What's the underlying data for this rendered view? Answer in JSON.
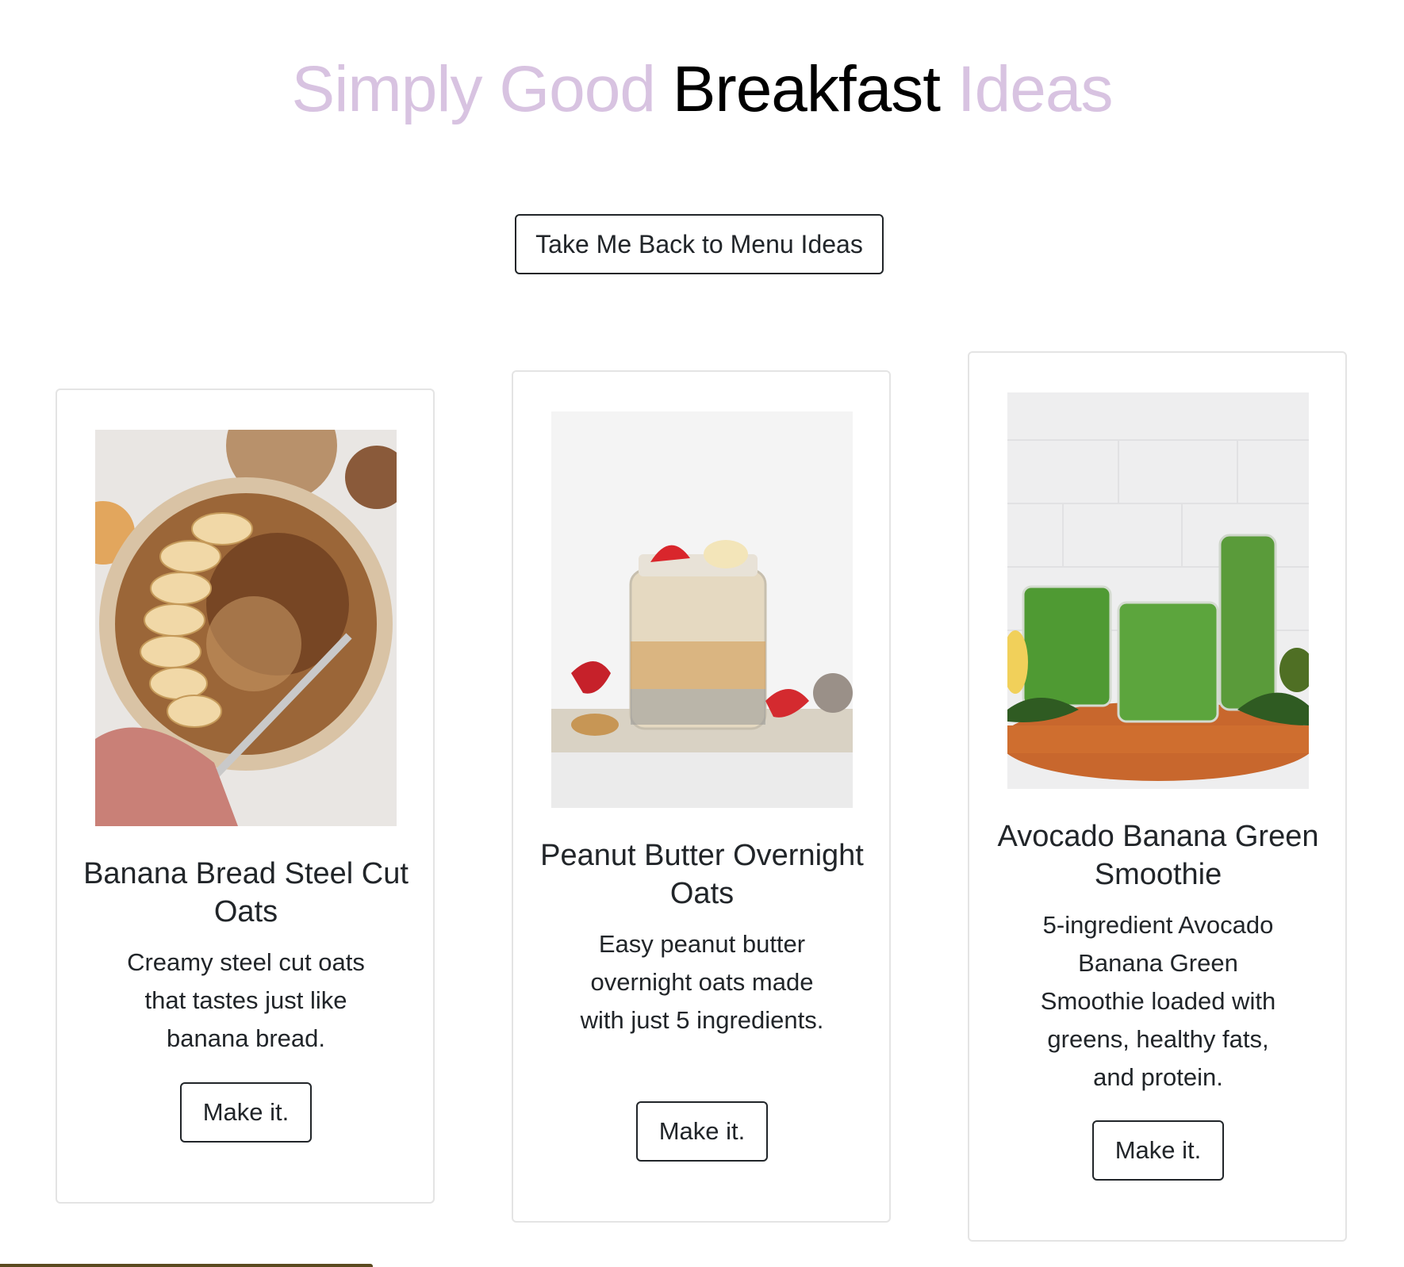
{
  "header": {
    "title_part1": "Simply Good ",
    "title_part2": "Breakfast",
    "title_part3": " Ideas",
    "accent_color": "#d8c3e1",
    "dark_color": "#000000"
  },
  "back_button": {
    "label": "Take Me Back to Menu Ideas"
  },
  "cards": [
    {
      "title": "Banana Bread Steel Cut Oats",
      "text": "Creamy steel cut oats that tastes just like banana bread.",
      "button": "Make it.",
      "image": "banana-oats-bowl-photo"
    },
    {
      "title": "Peanut Butter Overnight Oats",
      "text": "Easy peanut butter overnight oats made with just 5 ingredients.",
      "button": "Make it.",
      "image": "overnight-oats-jar-photo"
    },
    {
      "title": "Avocado Banana Green Smoothie",
      "text": "5-ingredient Avocado Banana Green Smoothie loaded with greens, healthy fats, and protein.",
      "button": "Make it.",
      "image": "green-smoothie-glasses-photo"
    }
  ]
}
